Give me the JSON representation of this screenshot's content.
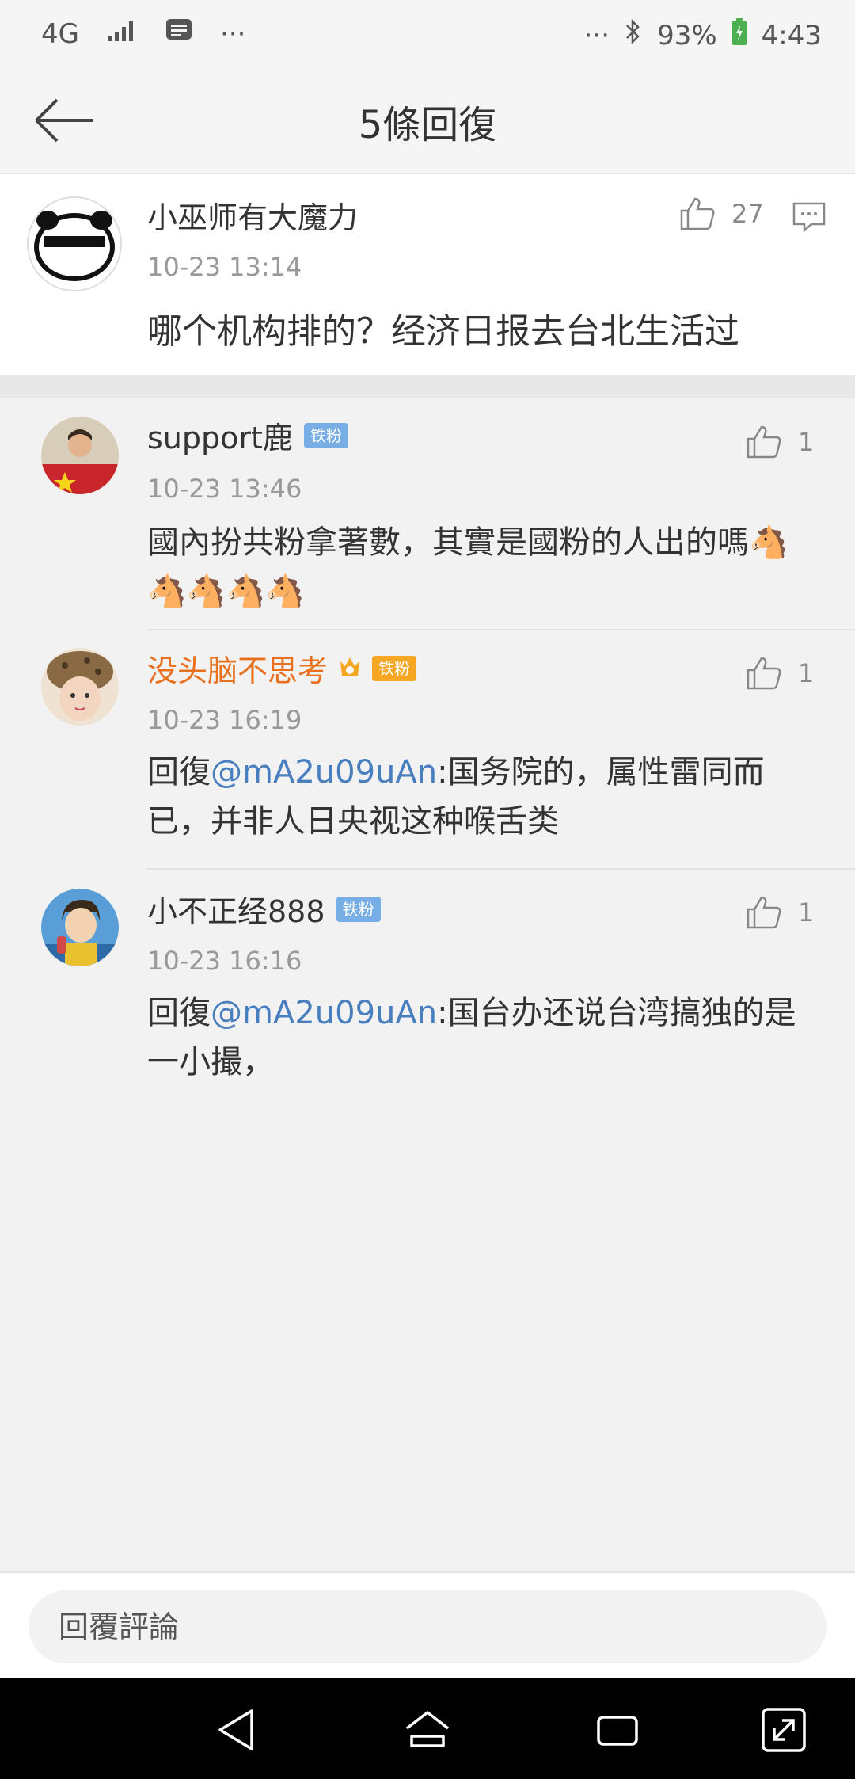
{
  "status": {
    "network": "4G",
    "dots": "···",
    "battery": "93%",
    "time": "4:43"
  },
  "header": {
    "title": "5條回復"
  },
  "main_comment": {
    "username": "小巫师有大魔力",
    "time": "10-23 13:14",
    "text": "哪个机构排的？经济日报去台北生活过",
    "likes": "27"
  },
  "replies": [
    {
      "username": "support鹿",
      "badge": "铁粉",
      "time": "10-23 13:46",
      "text": "國內扮共粉拿著數，其實是國粉的人出的嗎🐴🐴🐴🐴🐴",
      "likes": "1"
    },
    {
      "username": "没头脑不思考",
      "badge": "铁粉",
      "time": "10-23 16:19",
      "prefix": "回復",
      "mention": "@mA2u09uAn",
      "text": ":国务院的，属性雷同而已，并非人日央视这种喉舌类",
      "likes": "1"
    },
    {
      "username": "小不正经888",
      "badge": "铁粉",
      "time": "10-23 16:16",
      "prefix": "回復",
      "mention": "@mA2u09uAn",
      "text": ":国台办还说台湾搞独的是一小撮，",
      "likes": "1"
    }
  ],
  "footer": {
    "placeholder": "回覆評論"
  },
  "colors": {
    "accent_username": "#e8711f",
    "mention": "#4a7fbf",
    "badge": "#77aee6"
  }
}
